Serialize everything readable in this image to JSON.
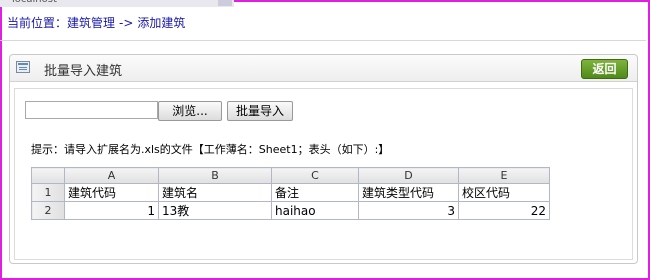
{
  "browser": {
    "tab_title": "localhost"
  },
  "breadcrumb": {
    "label": "当前位置：",
    "item1": "建筑管理",
    "arrow": "->",
    "item2": "添加建筑"
  },
  "panel": {
    "title": "批量导入建筑",
    "back_label": "返回"
  },
  "form": {
    "browse_label": "浏览...",
    "import_label": "批量导入",
    "file_value": ""
  },
  "hint": "提示：请导入扩展名为.xls的文件【工作薄名：Sheet1；表头（如下）:】",
  "sheet": {
    "columns": [
      "A",
      "B",
      "C",
      "D",
      "E"
    ],
    "rows": [
      {
        "num": "1",
        "cells": [
          "建筑代码",
          "建筑名",
          "备注",
          "建筑类型代码",
          "校区代码"
        ]
      },
      {
        "num": "2",
        "cells": [
          "1",
          "13教",
          "haihao",
          "3",
          "22"
        ]
      }
    ]
  },
  "colors": {
    "frame": "#e020e0",
    "back_button": "#5f9a22",
    "link": "#1a1aaa"
  }
}
